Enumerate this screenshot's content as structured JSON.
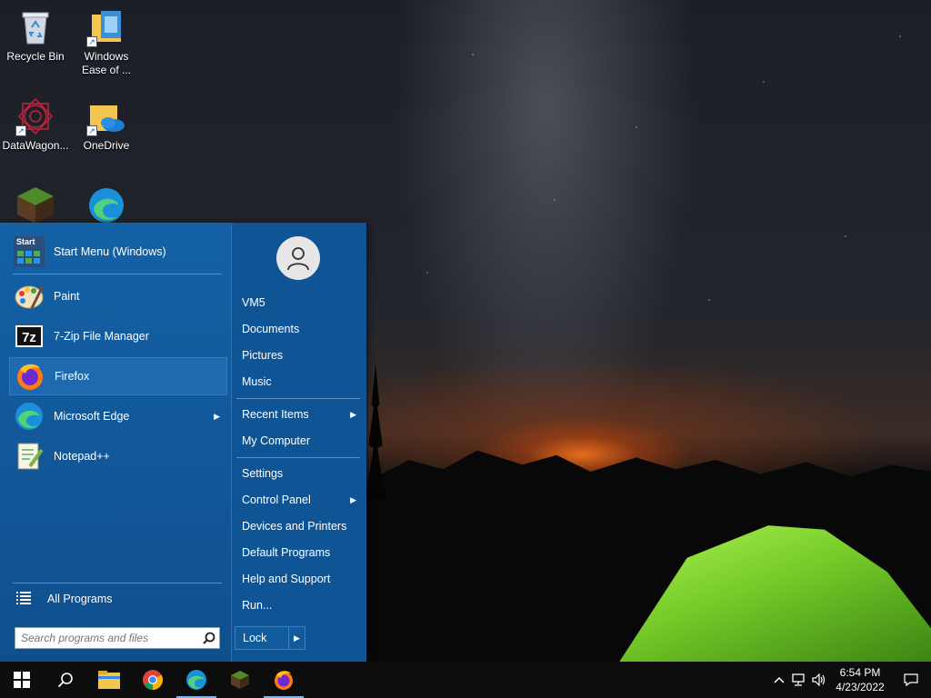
{
  "desktop": {
    "icons": [
      {
        "label": "Recycle Bin",
        "icon": "recycle-bin-icon"
      },
      {
        "label": "Windows Ease of ...",
        "icon": "folder-shortcut-icon"
      },
      {
        "label": "DataWagon...",
        "icon": "datawagon-icon"
      },
      {
        "label": "OneDrive",
        "icon": "onedrive-folder-icon"
      },
      {
        "label": "",
        "icon": "minecraft-icon"
      },
      {
        "label": "",
        "icon": "edge-icon"
      }
    ]
  },
  "start_menu": {
    "header_item": {
      "label": "Start Menu (Windows)",
      "icon": "start-menu-app-icon"
    },
    "pinned": [
      {
        "label": "Paint",
        "icon": "paint-icon",
        "submenu": false
      },
      {
        "label": "7-Zip File Manager",
        "icon": "7zip-icon",
        "submenu": false
      },
      {
        "label": "Firefox",
        "icon": "firefox-icon",
        "submenu": false,
        "selected": true
      },
      {
        "label": "Microsoft Edge",
        "icon": "edge-icon",
        "submenu": true
      },
      {
        "label": "Notepad++",
        "icon": "notepadpp-icon",
        "submenu": false
      }
    ],
    "all_programs": "All Programs",
    "search_placeholder": "Search programs and files",
    "places_group1": [
      {
        "label": "VM5",
        "submenu": false
      },
      {
        "label": "Documents",
        "submenu": false
      },
      {
        "label": "Pictures",
        "submenu": false
      },
      {
        "label": "Music",
        "submenu": false
      }
    ],
    "places_group2": [
      {
        "label": "Recent Items",
        "submenu": true
      },
      {
        "label": "My Computer",
        "submenu": false
      }
    ],
    "places_group3": [
      {
        "label": "Settings",
        "submenu": false
      },
      {
        "label": "Control Panel",
        "submenu": true
      },
      {
        "label": "Devices and Printers",
        "submenu": false
      },
      {
        "label": "Default Programs",
        "submenu": false
      },
      {
        "label": "Help and Support",
        "submenu": false
      },
      {
        "label": "Run...",
        "submenu": false
      }
    ],
    "lock_label": "Lock",
    "start_icon_text": "Start"
  },
  "taskbar": {
    "apps": [
      {
        "name": "file-explorer-icon",
        "running": false
      },
      {
        "name": "chrome-icon",
        "running": false
      },
      {
        "name": "edge-icon",
        "running": true
      },
      {
        "name": "minecraft-icon",
        "running": false
      },
      {
        "name": "firefox-icon",
        "running": true
      }
    ],
    "time": "6:54 PM",
    "date": "4/23/2022"
  },
  "colors": {
    "start_menu_bg": "#105a9c",
    "selection": "#1f6aae",
    "taskbar_bg": "#0d0d0d"
  }
}
